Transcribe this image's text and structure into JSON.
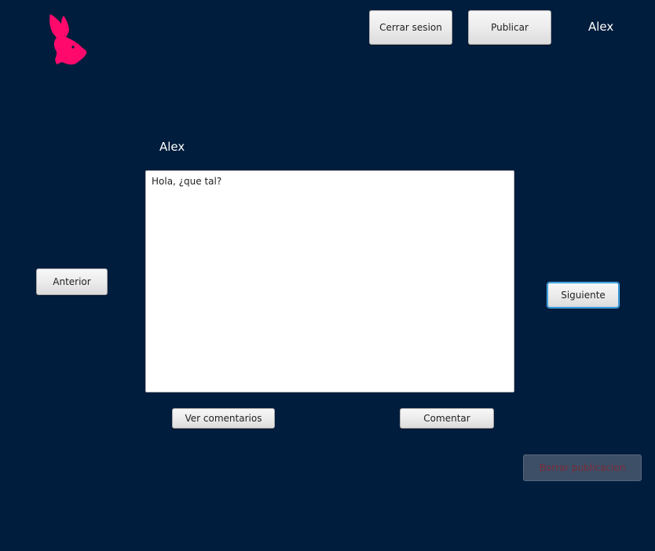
{
  "header": {
    "logout_label": "Cerrar sesion",
    "publish_label": "Publicar",
    "username": "Alex"
  },
  "logo": {
    "icon": "rabbit-head-icon",
    "color": "#ff0a6c"
  },
  "post": {
    "author": "Alex",
    "content": "Hola, ¿que tal?"
  },
  "navigation": {
    "previous_label": "Anterior",
    "next_label": "Siguiente"
  },
  "actions": {
    "view_comments_label": "Ver comentarios",
    "comment_label": "Comentar",
    "delete_post_label": "Borrar publicacion"
  },
  "colors": {
    "background": "#001d3d",
    "accent": "#ff0a6c",
    "focus": "#1e8fd6"
  }
}
